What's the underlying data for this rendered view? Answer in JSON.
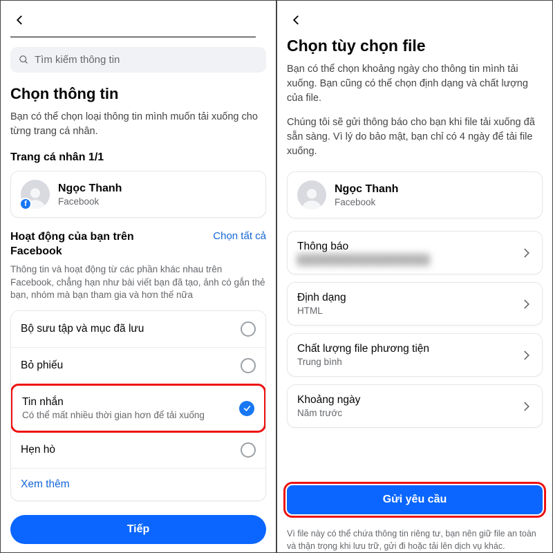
{
  "left": {
    "search_placeholder": "Tìm kiếm thông tin",
    "title": "Chọn thông tin",
    "desc": "Bạn có thể chọn loại thông tin mình muốn tải xuống cho từng trang cá nhân.",
    "section_label": "Trang cá nhân 1/1",
    "profile": {
      "name": "Ngọc Thanh",
      "source": "Facebook"
    },
    "activity_heading": "Hoạt động của bạn trên Facebook",
    "select_all": "Chọn tất cả",
    "activity_sub": "Thông tin và hoạt động từ các phần khác nhau trên Facebook, chẳng hạn như bài viết bạn đã tạo, ảnh có gắn thẻ bạn, nhóm mà bạn tham gia và hơn thế nữa",
    "items": [
      {
        "title": "Bộ sưu tập và mục đã lưu",
        "sub": "",
        "checked": false,
        "highlight": false
      },
      {
        "title": "Bỏ phiếu",
        "sub": "",
        "checked": false,
        "highlight": false
      },
      {
        "title": "Tin nhắn",
        "sub": "Có thể mất nhiều thời gian hơn để tải xuống",
        "checked": true,
        "highlight": true
      },
      {
        "title": "Hẹn hò",
        "sub": "",
        "checked": false,
        "highlight": false
      }
    ],
    "see_more": "Xem thêm",
    "primary_button": "Tiếp"
  },
  "right": {
    "title": "Chọn tùy chọn file",
    "desc1": "Bạn có thể chọn khoảng ngày cho thông tin mình tải xuống. Bạn cũng có thể chọn định dạng và chất lượng của file.",
    "desc2": "Chúng tôi sẽ gửi thông báo cho bạn khi file tải xuống đã sẵn sàng. Vì lý do bảo mật, bạn chỉ có 4 ngày để tải file xuống.",
    "profile": {
      "name": "Ngọc Thanh",
      "source": "Facebook"
    },
    "options": [
      {
        "title": "Thông báo",
        "sub": "████████████████████",
        "blur": true
      },
      {
        "title": "Định dạng",
        "sub": "HTML",
        "blur": false
      },
      {
        "title": "Chất lượng file phương tiện",
        "sub": "Trung bình",
        "blur": false
      },
      {
        "title": "Khoảng ngày",
        "sub": "Năm trước",
        "blur": false
      }
    ],
    "primary_button": "Gửi yêu cầu",
    "footer": "Vì file này có thể chứa thông tin riêng tư, bạn nên giữ file an toàn và thận trọng khi lưu trữ, gửi đi hoặc tải lên dịch vụ khác."
  }
}
